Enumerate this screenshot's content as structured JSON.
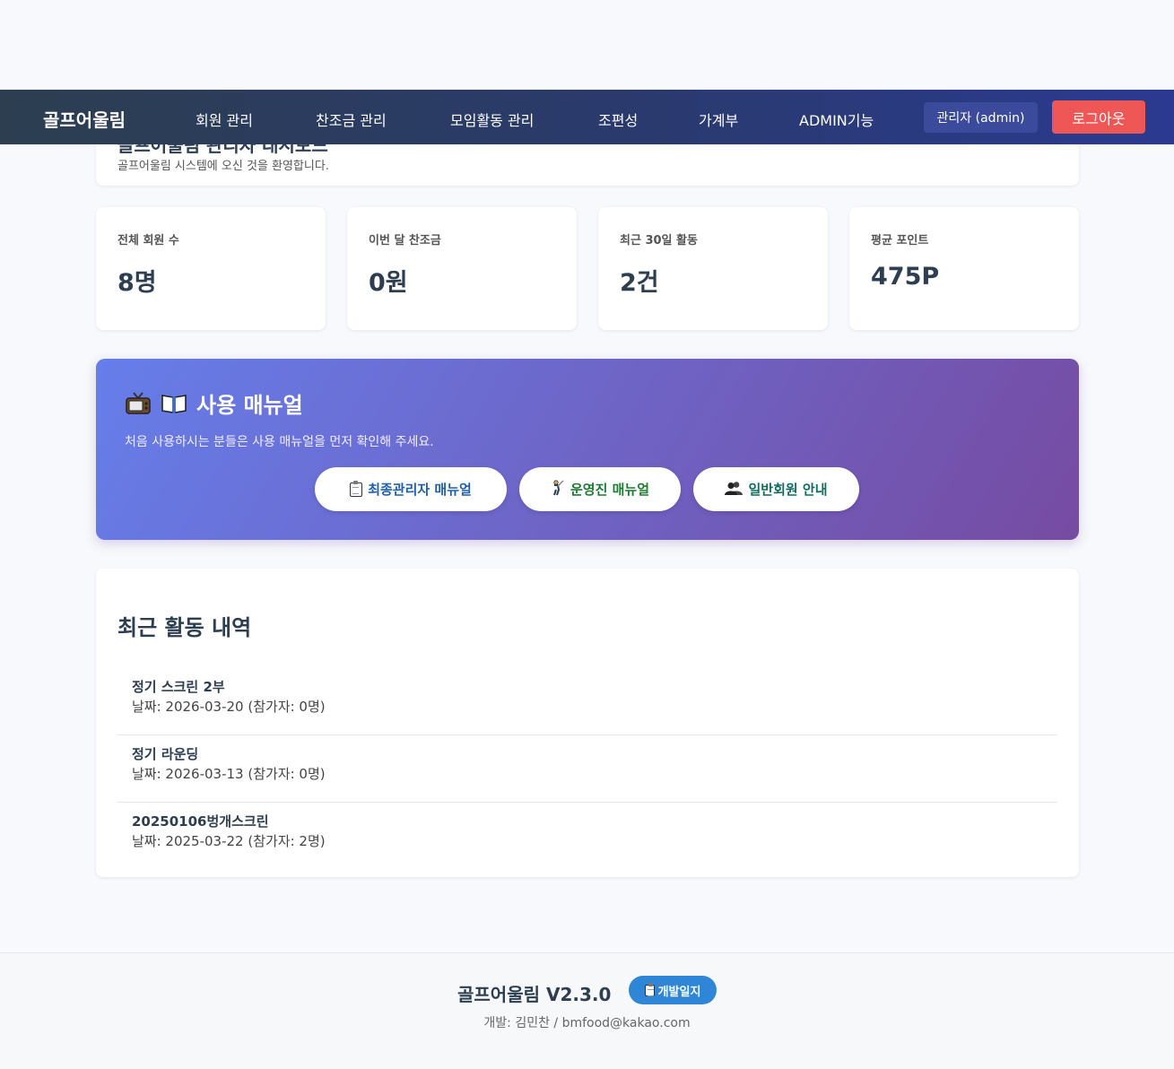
{
  "navbar": {
    "brand": "골프어울림",
    "items": [
      "회원 관리",
      "찬조금 관리",
      "모임활동 관리",
      "조편성",
      "가계부",
      "ADMIN기능"
    ],
    "user_badge": "관리자 (admin)",
    "logout_label": "로그아웃"
  },
  "welcome": {
    "title": "골프어울림 관리자 대시보드",
    "subtitle": "골프어울림 시스템에 오신 것을 환영합니다."
  },
  "stats": [
    {
      "label": "전체 회원 수",
      "value": "8명"
    },
    {
      "label": "이번 달 찬조금",
      "value": "0원"
    },
    {
      "label": "최근 30일 활동",
      "value": "2건"
    },
    {
      "label": "평균 포인트",
      "value": "475P"
    }
  ],
  "manual": {
    "title": "사용 매뉴얼",
    "description": "처음 사용하시는 분들은 사용 매뉴얼을 먼저 확인해 주세요.",
    "buttons": [
      {
        "label": "최종관리자 매뉴얼",
        "icon": "clipboard-icon",
        "color": "#1f5fa8"
      },
      {
        "label": "운영진 매뉴얼",
        "icon": "person-golfing-icon",
        "color": "#1e7a32"
      },
      {
        "label": "일반회원 안내",
        "icon": "users-icon",
        "color": "#136b60"
      }
    ]
  },
  "recent": {
    "title": "최근 활동 내역",
    "items": [
      {
        "name": "정기 스크린 2부",
        "date": "날짜: 2026-03-20 (참가자: 0명)"
      },
      {
        "name": "정기 라운딩",
        "date": "날짜: 2026-03-13 (참가자: 0명)"
      },
      {
        "name": "20250106벙개스크린",
        "date": "날짜: 2025-03-22 (참가자: 2명)"
      }
    ]
  },
  "footer": {
    "brand": "골프어울림 V2.3.0",
    "devlog_label": "개발일지",
    "credit": "개발: 김민찬 / bmfood@kakao.com"
  },
  "colors": {
    "navbar_start": "#2c3e50",
    "navbar_end": "#2b3a90",
    "logout": "#ef5656",
    "manual_start": "#667eea",
    "manual_end": "#764ba2",
    "devlog": "#2f86d6"
  }
}
